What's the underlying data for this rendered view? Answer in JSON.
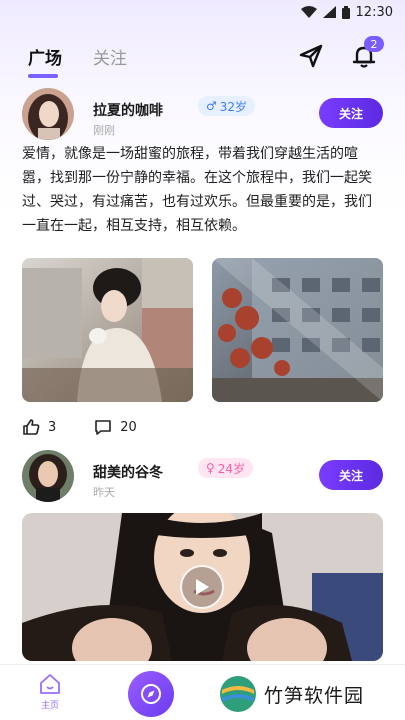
{
  "status_bar": {
    "time": "12:30"
  },
  "topnav": {
    "tabs": [
      {
        "label": "广场",
        "active": true
      },
      {
        "label": "关注",
        "active": false
      }
    ],
    "send_icon": "send-icon",
    "bell_icon": "bell-icon",
    "notification_count": "2"
  },
  "posts": [
    {
      "username": "拉夏的咖啡",
      "time": "刚刚",
      "gender": "male",
      "gender_symbol": "♂",
      "age": "32岁",
      "follow_label": "关注",
      "text": "爱情，就像是一场甜蜜的旅程，带着我们穿越生活的喧嚣，找到那一份宁静的幸福。在这个旅程中，我们一起笑过、哭过，有过痛苦，也有过欢乐。但最重要的是，我们一直在一起，相互支持，相互依赖。",
      "likes": "3",
      "comments": "20"
    },
    {
      "username": "甜美的谷冬",
      "time": "昨天",
      "gender": "female",
      "gender_symbol": "♀",
      "age": "24岁",
      "follow_label": "关注"
    }
  ],
  "bottom_nav": {
    "home_label": "主页"
  },
  "watermark": {
    "text": "竹笋软件园"
  },
  "colors": {
    "accent": "#7b5cff",
    "follow_button": "#6a32f0",
    "male_badge": "#3f7bff",
    "female_badge": "#ff5aa5"
  }
}
